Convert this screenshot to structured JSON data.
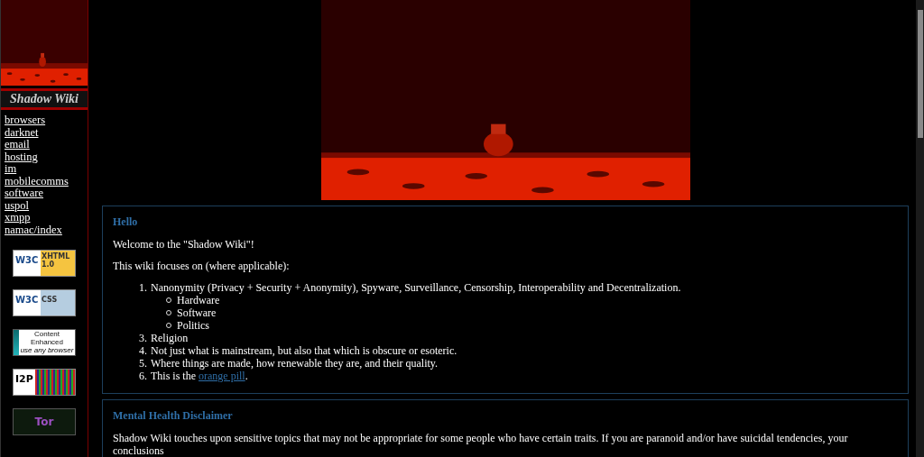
{
  "sidebar": {
    "title": "Shadow Wiki",
    "links": [
      "browsers",
      "darknet",
      "email",
      "hosting",
      "im",
      "mobilecomms",
      "software",
      "uspol",
      "xmpp",
      "namac/index"
    ],
    "badges": [
      {
        "kind": "w3c",
        "texts": [
          "W3C",
          "XHTML",
          "1.0"
        ]
      },
      {
        "kind": "w3c",
        "texts": [
          "W3C",
          "CSS"
        ]
      },
      {
        "kind": "content",
        "texts": [
          "Content",
          "Enhanced",
          "use any browser"
        ]
      },
      {
        "kind": "i2p",
        "texts": [
          "I2P"
        ]
      },
      {
        "kind": "tor",
        "texts": [
          "Tor"
        ]
      }
    ]
  },
  "sections": [
    {
      "heading": "Hello",
      "paragraphs": [
        "Welcome to the \"Shadow Wiki\"!",
        "This wiki focuses on (where applicable):"
      ],
      "list": [
        {
          "number": "1.",
          "text": "Nanonymity (Privacy + Security + Anonymity), Spyware, Surveillance, Censorship, Interoperability and Decentralization.",
          "children": [
            {
              "text": "Hardware"
            },
            {
              "text": "Software"
            },
            {
              "text": "Politics"
            }
          ]
        },
        {
          "number": "3.",
          "text": "Religion"
        },
        {
          "number": "4.",
          "text": "Not just what is mainstream, but also that which is obscure or esoteric."
        },
        {
          "number": "5.",
          "text": "Where things are made, how renewable they are, and their quality."
        },
        {
          "number": "6.",
          "text": "This is the ",
          "link": "orange pill",
          "after": "."
        }
      ]
    },
    {
      "heading": "Mental Health Disclaimer",
      "paragraphs": [
        "Shadow Wiki touches upon sensitive topics that may not be appropriate for some people who have certain traits. If you are paranoid and/or have suicidal tendencies, your conclusions"
      ]
    }
  ]
}
